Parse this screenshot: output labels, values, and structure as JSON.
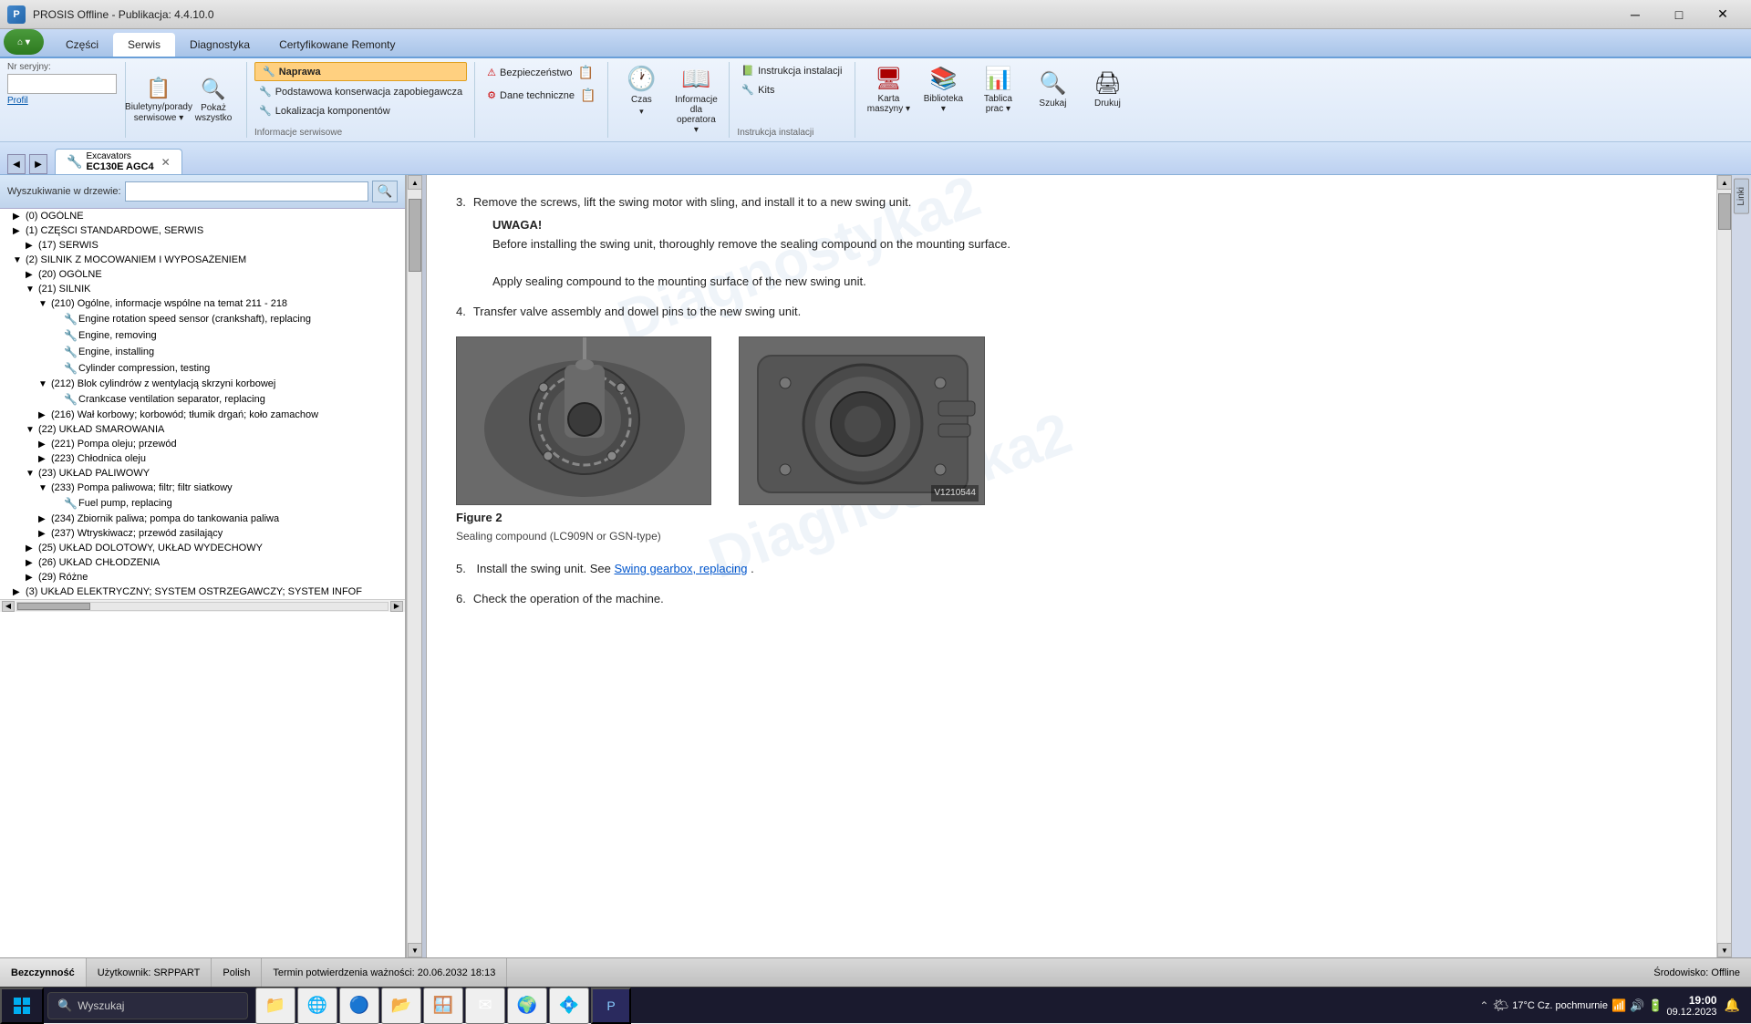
{
  "app": {
    "title": "PROSIS Offline - Publikacja: 4.4.10.0",
    "version": "4.4.10.0"
  },
  "ribbon": {
    "tabs": [
      {
        "id": "czesci",
        "label": "Części"
      },
      {
        "id": "serwis",
        "label": "Serwis",
        "active": true
      },
      {
        "id": "diagnostyka",
        "label": "Diagnostyka"
      },
      {
        "id": "certyfikowane",
        "label": "Certyfikowane Remonty"
      }
    ],
    "sections": {
      "profil": {
        "serial_label": "Nr seryjny:",
        "profile_label": "Profil"
      },
      "biuletyny": {
        "label": "Biuletyny/porady serwisowe ▾"
      },
      "pokaz": {
        "label": "Pokaż\nwszystko"
      },
      "naprawa": {
        "label": "Naprawa"
      },
      "konserwacja": {
        "label": "Podstawowa konserwacja zapobiegawcza"
      },
      "lokalizacja": {
        "label": "Lokalizacja komponentów"
      },
      "info_serwisowe": {
        "section_label": "Informacje serwisowe"
      },
      "bezpieczenstwo": {
        "label": "Bezpieczeństwo"
      },
      "dane_tech": {
        "label": "Dane techniczne"
      },
      "czas": {
        "label": "Czas"
      },
      "info_dla_op": {
        "label": "Informacje dla\noperatora ▾"
      },
      "instr_inst": {
        "label": "Instrukcja instalacji",
        "kits_label": "Kits",
        "section_label": "Instrukcja instalacji"
      },
      "karta": {
        "label": "Karta\nmaszyny ▾"
      },
      "biblioteka": {
        "label": "Biblioteka ▾"
      },
      "tablica": {
        "label": "Tablica\nprac ▾"
      },
      "szukaj": {
        "label": "Szukaj"
      },
      "drukuj": {
        "label": "Drukuj"
      }
    }
  },
  "doc_tab": {
    "machine": "Excavators",
    "model": "EC130E AGC4"
  },
  "search": {
    "label": "Wyszukiwanie w drzewie:",
    "placeholder": ""
  },
  "tree": {
    "items": [
      {
        "id": "0-ogolne",
        "label": "(0) OGÓLNE",
        "level": 1,
        "expanded": false,
        "has_children": true
      },
      {
        "id": "1-czesci",
        "label": "(1) CZĘŚCI STANDARDOWE, SERWIS",
        "level": 1,
        "expanded": false,
        "has_children": true
      },
      {
        "id": "17-serwis",
        "label": "(17) SERWIS",
        "level": 2,
        "expanded": false,
        "has_children": true
      },
      {
        "id": "2-silnik",
        "label": "(2) SILNIK Z MOCOWANIEM I WYPOSAŻENIEM",
        "level": 1,
        "expanded": true,
        "has_children": true
      },
      {
        "id": "20-ogolne",
        "label": "(20) OGÓLNE",
        "level": 2,
        "expanded": false,
        "has_children": true
      },
      {
        "id": "21-silnik",
        "label": "(21) SILNIK",
        "level": 2,
        "expanded": true,
        "has_children": true
      },
      {
        "id": "210-ogolne",
        "label": "(210) Ogólne, informacje wspólne na temat 211 - 218",
        "level": 3,
        "expanded": true,
        "has_children": true
      },
      {
        "id": "engine-rotation",
        "label": "Engine rotation speed sensor (crankshaft), replacing",
        "level": 4,
        "icon": "wrench",
        "has_children": false
      },
      {
        "id": "engine-removing",
        "label": "Engine, removing",
        "level": 4,
        "icon": "wrench",
        "has_children": false
      },
      {
        "id": "engine-installing",
        "label": "Engine, installing",
        "level": 4,
        "icon": "wrench",
        "has_children": false
      },
      {
        "id": "cylinder-compression",
        "label": "Cylinder compression, testing",
        "level": 4,
        "icon": "wrench",
        "has_children": false
      },
      {
        "id": "212-blok",
        "label": "(212) Blok cylindrów z wentylacją skrzyni korbowej",
        "level": 3,
        "expanded": false,
        "has_children": true
      },
      {
        "id": "crankcase",
        "label": "Crankcase ventilation  separator, replacing",
        "level": 4,
        "icon": "wrench",
        "has_children": false
      },
      {
        "id": "216-wal",
        "label": "(216) Wał korbowy; korbowód; tłumik drgań; koło zamachow",
        "level": 3,
        "expanded": false,
        "has_children": true
      },
      {
        "id": "22-smarowanie",
        "label": "(22) UKŁAD SMAROWANIA",
        "level": 2,
        "expanded": true,
        "has_children": true
      },
      {
        "id": "221-pompa",
        "label": "(221) Pompa oleju; przewód",
        "level": 3,
        "expanded": false,
        "has_children": false
      },
      {
        "id": "223-chlodnica",
        "label": "(223) Chłodnica oleju",
        "level": 3,
        "expanded": false,
        "has_children": false
      },
      {
        "id": "23-paliwowy",
        "label": "(23) UKŁAD PALIWOWY",
        "level": 2,
        "expanded": true,
        "has_children": true
      },
      {
        "id": "233-pompa",
        "label": "(233) Pompa paliwowa; filtr; filtr siatkowy",
        "level": 3,
        "expanded": true,
        "has_children": true
      },
      {
        "id": "fuel-pump",
        "label": "Fuel pump, replacing",
        "level": 4,
        "icon": "wrench",
        "has_children": false
      },
      {
        "id": "234-zbiornik",
        "label": "(234) Zbiornik paliwa; pompa do tankowania paliwa",
        "level": 3,
        "expanded": false,
        "has_children": false
      },
      {
        "id": "237-wtryskiwacz",
        "label": "(237) Wtryskiwacz; przewód zasilający",
        "level": 3,
        "expanded": false,
        "has_children": false
      },
      {
        "id": "25-dolotowy",
        "label": "(25) UKŁAD DOLOTOWY, UKŁAD WYDECHOWY",
        "level": 2,
        "expanded": false,
        "has_children": true
      },
      {
        "id": "26-chlodzenia",
        "label": "(26) UKŁAD CHŁODZENIA",
        "level": 2,
        "expanded": false,
        "has_children": true
      },
      {
        "id": "29-rozne",
        "label": "(29) Różne",
        "level": 2,
        "expanded": false,
        "has_children": true
      },
      {
        "id": "3-elektryczny",
        "label": "(3) UKŁAD ELEKTRYCZNY; SYSTEM OSTRZEGAWCZY; SYSTEM INFOF",
        "level": 1,
        "expanded": false,
        "has_children": true
      }
    ]
  },
  "content": {
    "steps": [
      {
        "number": "3.",
        "text": "Remove the screws, lift the swing motor with sling, and install it to a new swing unit.",
        "warning_title": "UWAGA!",
        "warning_text": "Before installing the swing unit, thoroughly remove the sealing compound on the mounting surface.",
        "extra_text": "Apply sealing compound to the mounting surface of the new swing unit."
      },
      {
        "number": "4.",
        "text": "Transfer valve assembly and dowel pins to the new swing unit."
      },
      {
        "figure_label": "Figure 2",
        "figure_desc": "Sealing compound (LC909N or GSN-type)",
        "image_ref": "V1210544"
      },
      {
        "number": "5.",
        "text": "Install the swing unit. See ",
        "link": "Swing gearbox, replacing",
        "text_after": " ."
      },
      {
        "number": "6.",
        "text": "Check the operation of the machine."
      }
    ]
  },
  "status_bar": {
    "state": "Bezczynność",
    "user_label": "Użytkownik: SRPPART",
    "language": "Polish",
    "validity": "Termin potwierdzenia ważności: 20.06.2032 18:13",
    "environment": "Środowisko: Offline"
  },
  "taskbar": {
    "search_placeholder": "Wyszukaj",
    "time": "19:00",
    "date": "09.12.2023",
    "weather": "17°C Cz. pochmurnie"
  },
  "watermarks": [
    "Diagnostyka2",
    "Diagnostyka2"
  ]
}
